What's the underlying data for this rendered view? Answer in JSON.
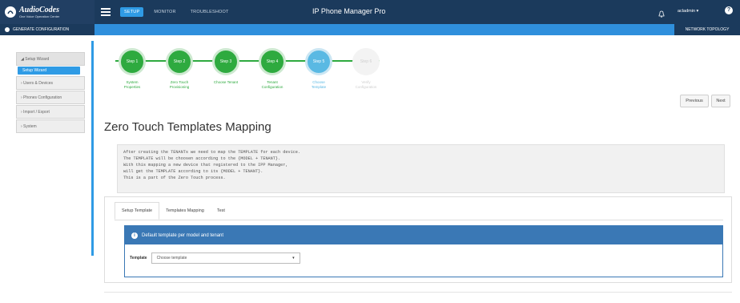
{
  "brand": {
    "name": "AudioCodes",
    "tagline": "One Voice Operation Center"
  },
  "topbar": {
    "tabs": [
      {
        "label": "SETUP",
        "active": true
      },
      {
        "label": "MONITOR",
        "active": false
      },
      {
        "label": "TROUBLESHOOT",
        "active": false
      }
    ],
    "app_title": "IP Phone Manager Pro",
    "user": "acladmin ▾",
    "help": "?"
  },
  "subbar": {
    "generate": "GENERATE CONFIGURATION",
    "network": "NETWORK TOPOLOGY"
  },
  "sidebar": {
    "items": [
      {
        "label": "◢ Setup Wizard"
      },
      {
        "label": "Setup Wizard"
      },
      {
        "label": "› Users & Devices"
      },
      {
        "label": "› Phones Configuration"
      },
      {
        "label": "› Import / Export"
      },
      {
        "label": "› System"
      }
    ]
  },
  "wizard": {
    "steps": [
      {
        "circle": "Step 1",
        "label1": "System",
        "label2": "Properties"
      },
      {
        "circle": "Step 2",
        "label1": "Zero Touch",
        "label2": "Provisioning"
      },
      {
        "circle": "Step 3",
        "label1": "Choose Tenant",
        "label2": ""
      },
      {
        "circle": "Step 4",
        "label1": "Tenant",
        "label2": "Configuration"
      },
      {
        "circle": "Step 5",
        "label1": "Choose",
        "label2": "Template"
      },
      {
        "circle": "Step 6",
        "label1": "Verify",
        "label2": "Configuration"
      }
    ],
    "previous": "Previous",
    "next": "Next"
  },
  "page": {
    "title": "Zero Touch Templates Mapping"
  },
  "info": {
    "lines": [
      "After creating the TENANTs we need to map the TEMPLATE for each device.",
      "The TEMPLATE will be choosen according to the {MODEL + TENANT}.",
      "With this mapping a new device that registered to the IPP Manager,",
      "will get the TEMPLATE according to its {MODEL + TENANT}.",
      "This is a part of the Zero Touch process."
    ]
  },
  "tabs": [
    {
      "label": "Setup Template",
      "active": true
    },
    {
      "label": "Templates Mapping",
      "active": false
    },
    {
      "label": "Test",
      "active": false
    }
  ],
  "box": {
    "title": "Default template per model and tenant",
    "field_label": "Template",
    "select_value": "Choose template"
  },
  "colors": {
    "navbar": "#1b3a5c",
    "accent": "#2f9be5",
    "step_done": "#2eaa3f",
    "step_current": "#5ab9e3",
    "panel_head": "#3a78b5"
  }
}
